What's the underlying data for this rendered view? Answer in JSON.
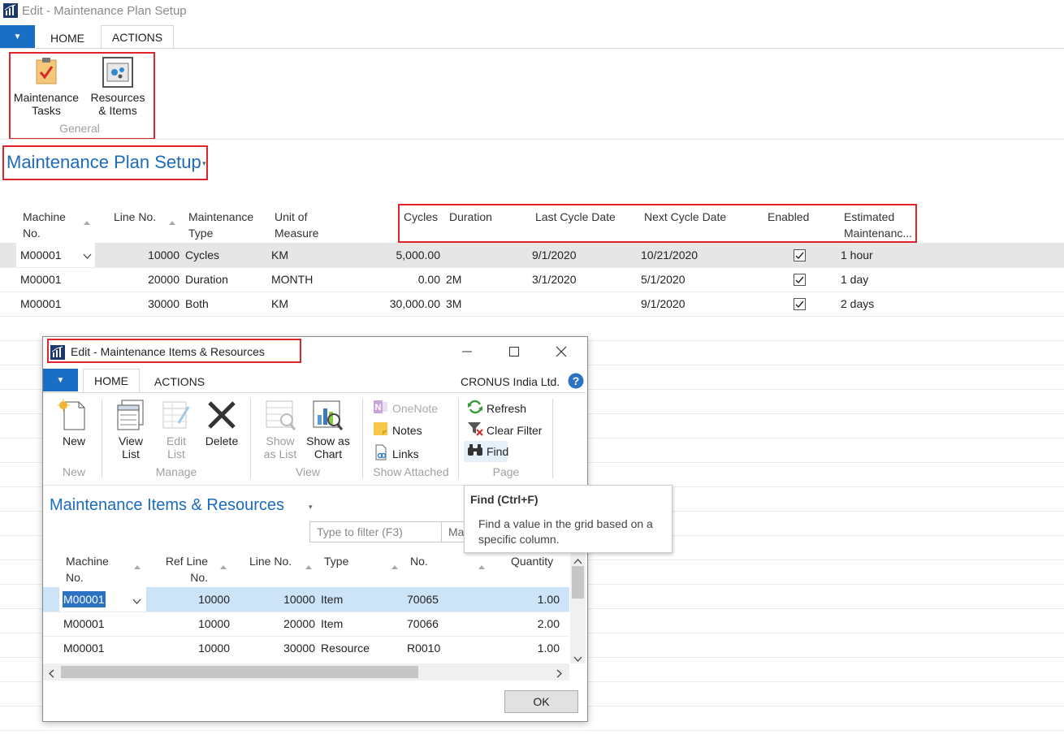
{
  "window": {
    "title": "Edit - Maintenance Plan Setup"
  },
  "tabs": [
    {
      "label": "HOME"
    },
    {
      "label": "ACTIONS"
    }
  ],
  "ribbon": {
    "buttons": [
      {
        "label1": "Maintenance",
        "label2": "Tasks"
      },
      {
        "label1": "Resources",
        "label2": "& Items"
      }
    ],
    "group": "General"
  },
  "page": {
    "title": "Maintenance Plan Setup"
  },
  "grid": {
    "headers": [
      {
        "l1": "Machine",
        "l2": "No."
      },
      {
        "l1": "Line No.",
        "l2": ""
      },
      {
        "l1": "Maintenance",
        "l2": "Type"
      },
      {
        "l1": "Unit of",
        "l2": "Measure"
      },
      {
        "l1": "Cycles",
        "l2": ""
      },
      {
        "l1": "Duration",
        "l2": ""
      },
      {
        "l1": "Last Cycle Date",
        "l2": ""
      },
      {
        "l1": "Next Cycle Date",
        "l2": ""
      },
      {
        "l1": "Enabled",
        "l2": ""
      },
      {
        "l1": "Estimated",
        "l2": "Maintenanc..."
      }
    ],
    "rows": [
      {
        "machine": "M00001",
        "line": "10000",
        "type": "Cycles",
        "uom": "KM",
        "cycles": "5,000.00",
        "duration": "",
        "last": "9/1/2020",
        "next": "10/21/2020",
        "enabled": true,
        "est": "1 hour"
      },
      {
        "machine": "M00001",
        "line": "20000",
        "type": "Duration",
        "uom": "MONTH",
        "cycles": "0.00",
        "duration": "2M",
        "last": "3/1/2020",
        "next": "5/1/2020",
        "enabled": true,
        "est": "1 day"
      },
      {
        "machine": "M00001",
        "line": "30000",
        "type": "Both",
        "uom": "KM",
        "cycles": "30,000.00",
        "duration": "3M",
        "last": "",
        "next": "9/1/2020",
        "enabled": true,
        "est": "2 days"
      }
    ]
  },
  "dialog": {
    "title": "Edit - Maintenance Items & Resources",
    "tabs": [
      {
        "label": "HOME"
      },
      {
        "label": "ACTIONS"
      }
    ],
    "company": "CRONUS India Ltd.",
    "ribbon": {
      "new": "New",
      "view_list": {
        "l1": "View",
        "l2": "List"
      },
      "edit_list": {
        "l1": "Edit",
        "l2": "List"
      },
      "delete": "Delete",
      "show_as_list": {
        "l1": "Show",
        "l2": "as List"
      },
      "show_as_chart": {
        "l1": "Show as",
        "l2": "Chart"
      },
      "onenote": "OneNote",
      "notes": "Notes",
      "links": "Links",
      "refresh": "Refresh",
      "clear_filter": "Clear Filter",
      "find": "Find",
      "groups": {
        "new": "New",
        "manage": "Manage",
        "view": "View",
        "show_attached": "Show Attached",
        "page": "Page"
      }
    },
    "page_title": "Maintenance Items & Resources",
    "filter": {
      "placeholder": "Type to filter (F3)",
      "field": "Ma"
    },
    "headers": [
      {
        "l1": "Machine",
        "l2": "No."
      },
      {
        "l1": "Ref Line",
        "l2": "No."
      },
      {
        "l1": "Line No.",
        "l2": ""
      },
      {
        "l1": "Type",
        "l2": ""
      },
      {
        "l1": "No.",
        "l2": ""
      },
      {
        "l1": "Quantity",
        "l2": ""
      }
    ],
    "rows": [
      {
        "machine": "M00001",
        "ref": "10000",
        "line": "10000",
        "type": "Item",
        "no": "70065",
        "qty": "1.00"
      },
      {
        "machine": "M00001",
        "ref": "10000",
        "line": "20000",
        "type": "Item",
        "no": "70066",
        "qty": "2.00"
      },
      {
        "machine": "M00001",
        "ref": "10000",
        "line": "30000",
        "type": "Resource",
        "no": "R0010",
        "qty": "1.00"
      }
    ],
    "ok": "OK"
  },
  "tooltip": {
    "title": "Find (Ctrl+F)",
    "line1": "Find a value in the grid based on a",
    "line2": "specific column."
  },
  "colors": {
    "accent": "#1c6bbf",
    "highlight": "#e0242b",
    "selected_row": "#e6e6e6",
    "dialog_selected_row": "#cde3f7"
  }
}
